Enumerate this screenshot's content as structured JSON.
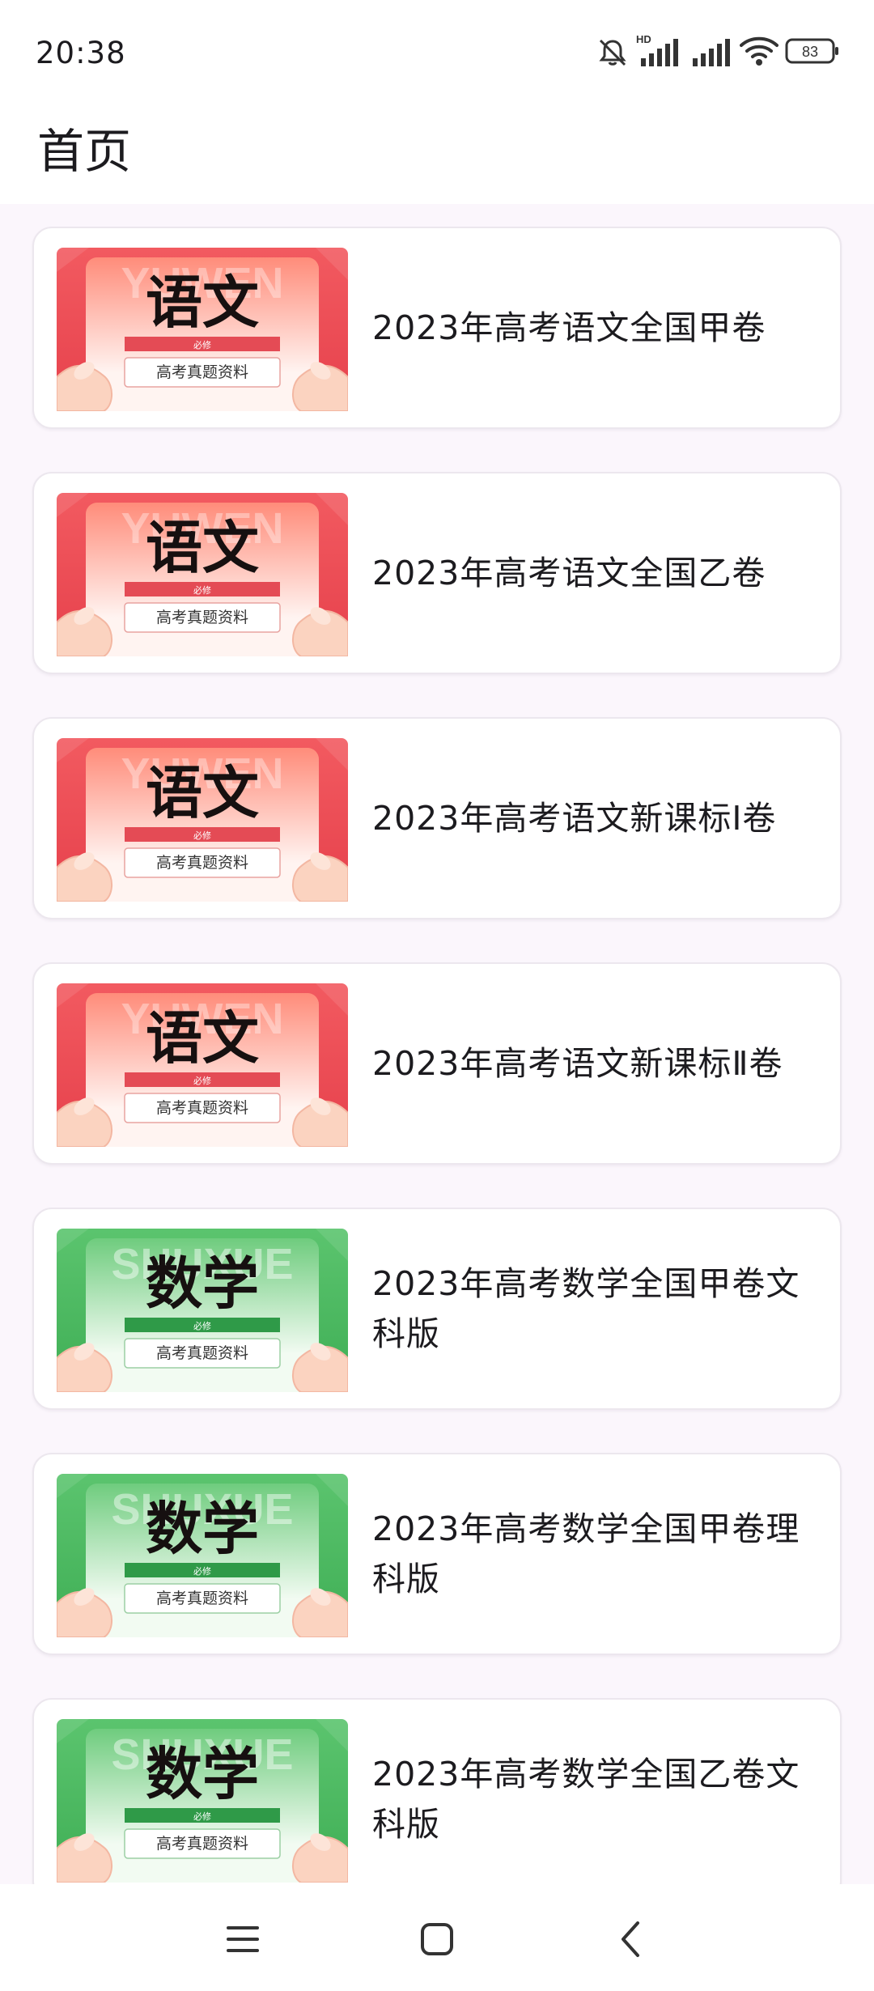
{
  "status_bar": {
    "time": "20:38",
    "hd_label": "HD",
    "battery_level": "83",
    "icons": [
      "mute-bell-icon",
      "hd-signal-icon",
      "signal-icon",
      "wifi-icon",
      "battery-icon"
    ]
  },
  "app_bar": {
    "title": "首页"
  },
  "colors": {
    "chinese_theme": "#e8505b",
    "math_theme": "#3fb45b",
    "background": "#fbf6fc"
  },
  "items": [
    {
      "title": "2023年高考语文全国甲卷",
      "thumb": {
        "subject": "语文",
        "watermark": "YUWEN",
        "tag": "必修",
        "caption": "高考真题资料",
        "theme": "red"
      }
    },
    {
      "title": "2023年高考语文全国乙卷",
      "thumb": {
        "subject": "语文",
        "watermark": "YUWEN",
        "tag": "必修",
        "caption": "高考真题资料",
        "theme": "red"
      }
    },
    {
      "title": "2023年高考语文新课标Ⅰ卷",
      "thumb": {
        "subject": "语文",
        "watermark": "YUWEN",
        "tag": "必修",
        "caption": "高考真题资料",
        "theme": "red"
      }
    },
    {
      "title": "2023年高考语文新课标Ⅱ卷",
      "thumb": {
        "subject": "语文",
        "watermark": "YUWEN",
        "tag": "必修",
        "caption": "高考真题资料",
        "theme": "red"
      }
    },
    {
      "title": "2023年高考数学全国甲卷文科版",
      "thumb": {
        "subject": "数学",
        "watermark": "SHUXUE",
        "tag": "必修",
        "caption": "高考真题资料",
        "theme": "green"
      }
    },
    {
      "title": "2023年高考数学全国甲卷理科版",
      "thumb": {
        "subject": "数学",
        "watermark": "SHUXUE",
        "tag": "必修",
        "caption": "高考真题资料",
        "theme": "green"
      }
    },
    {
      "title": "2023年高考数学全国乙卷文科版",
      "thumb": {
        "subject": "数学",
        "watermark": "SHUXUE",
        "tag": "必修",
        "caption": "高考真题资料",
        "theme": "green"
      }
    }
  ],
  "nav_bar": {
    "buttons": [
      "menu-icon",
      "home-square-icon",
      "back-chevron-icon"
    ]
  }
}
